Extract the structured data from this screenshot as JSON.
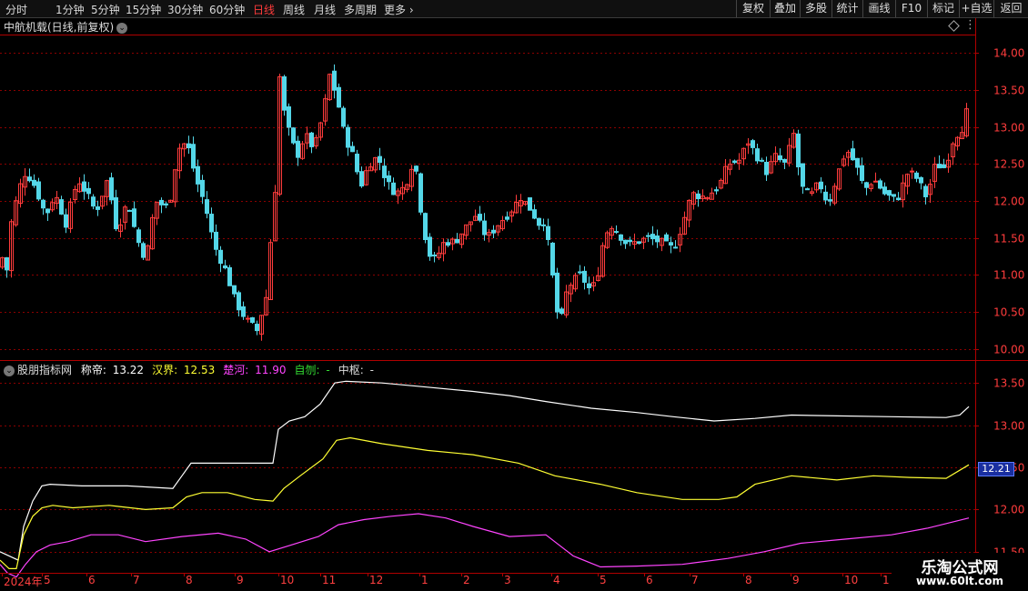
{
  "toolbar": {
    "periods": [
      "分时",
      "1分钟",
      "5分钟",
      "15分钟",
      "30分钟",
      "60分钟",
      "日线",
      "周线",
      "月线",
      "多周期",
      "更多"
    ],
    "active_period": "日线",
    "buttons": [
      "复权",
      "叠加",
      "多股",
      "统计",
      "画线",
      "F10",
      "标记",
      "+自选",
      "返回"
    ]
  },
  "main_chart": {
    "title": "中航机载(日线,前复权)",
    "y_ticks": [
      "14.00",
      "13.50",
      "13.00",
      "12.50",
      "12.00",
      "11.50",
      "11.00",
      "10.50",
      "10.00"
    ],
    "y_range": [
      9.85,
      14.25
    ]
  },
  "indicator": {
    "name": "股朋指标网",
    "items": [
      {
        "label": "称帝:",
        "value": "13.22",
        "color": "#ffffff"
      },
      {
        "label": "汉界:",
        "value": "12.53",
        "color": "#ffff33"
      },
      {
        "label": "楚河:",
        "value": "11.90",
        "color": "#ff44ff"
      },
      {
        "label": "自刎:",
        "value": "-",
        "color": "#33dd33"
      },
      {
        "label": "中枢:",
        "value": "-",
        "color": "#dddddd"
      }
    ],
    "y_ticks": [
      "13.50",
      "13.00",
      "12.50",
      "12.00",
      "11.50"
    ],
    "y_range": [
      11.25,
      13.75
    ],
    "current_price_tag": "12.21"
  },
  "x_axis": {
    "labels": [
      "2024年",
      "5",
      "6",
      "7",
      "8",
      "9",
      "10",
      "11",
      "12",
      "1",
      "2",
      "3",
      "4",
      "5",
      "6",
      "7",
      "8",
      "9",
      "10",
      "1"
    ]
  },
  "watermark": {
    "line1": "乐淘公式网",
    "line2": "www.60lt.com"
  },
  "colors": {
    "up": "#ff3c3c",
    "down": "#54d7e8",
    "grid": "#8b0000",
    "axis": "#b00000"
  },
  "chart_data": [
    {
      "type": "candlestick",
      "title": "中航机载(日线,前复权)",
      "ylim": [
        9.85,
        14.25
      ],
      "anchors_close": [
        [
          0,
          11.1
        ],
        [
          3,
          11.3
        ],
        [
          6,
          10.9
        ],
        [
          10,
          11.6
        ],
        [
          20,
          12.15
        ],
        [
          28,
          12.4
        ],
        [
          38,
          12.2
        ],
        [
          50,
          11.8
        ],
        [
          60,
          12.1
        ],
        [
          72,
          11.7
        ],
        [
          85,
          12.3
        ],
        [
          95,
          12.1
        ],
        [
          105,
          11.85
        ],
        [
          118,
          12.3
        ],
        [
          128,
          11.6
        ],
        [
          140,
          12.0
        ],
        [
          150,
          11.5
        ],
        [
          160,
          11.2
        ],
        [
          170,
          12.0
        ],
        [
          185,
          11.9
        ],
        [
          195,
          12.7
        ],
        [
          205,
          12.8
        ],
        [
          215,
          12.3
        ],
        [
          225,
          11.95
        ],
        [
          235,
          11.4
        ],
        [
          248,
          11.05
        ],
        [
          258,
          10.65
        ],
        [
          270,
          10.4
        ],
        [
          282,
          10.25
        ],
        [
          292,
          10.7
        ],
        [
          298,
          11.6
        ],
        [
          303,
          12.3
        ],
        [
          306,
          13.8
        ],
        [
          310,
          13.3
        ],
        [
          318,
          12.9
        ],
        [
          326,
          12.6
        ],
        [
          335,
          12.9
        ],
        [
          345,
          12.7
        ],
        [
          355,
          13.2
        ],
        [
          362,
          13.7
        ],
        [
          370,
          13.4
        ],
        [
          378,
          12.9
        ],
        [
          388,
          12.6
        ],
        [
          396,
          12.2
        ],
        [
          405,
          12.5
        ],
        [
          415,
          12.6
        ],
        [
          425,
          12.25
        ],
        [
          435,
          12.1
        ],
        [
          445,
          12.2
        ],
        [
          455,
          12.6
        ],
        [
          462,
          11.9
        ],
        [
          470,
          11.3
        ],
        [
          478,
          11.2
        ],
        [
          488,
          11.45
        ],
        [
          500,
          11.45
        ],
        [
          512,
          11.65
        ],
        [
          522,
          11.8
        ],
        [
          535,
          11.5
        ],
        [
          548,
          11.7
        ],
        [
          560,
          11.85
        ],
        [
          572,
          12.05
        ],
        [
          582,
          11.9
        ],
        [
          592,
          11.7
        ],
        [
          600,
          11.75
        ],
        [
          604,
          11.1
        ],
        [
          610,
          10.85
        ],
        [
          614,
          10.15
        ],
        [
          620,
          10.7
        ],
        [
          628,
          10.9
        ],
        [
          638,
          11.0
        ],
        [
          648,
          10.8
        ],
        [
          655,
          10.9
        ],
        [
          662,
          11.4
        ],
        [
          670,
          11.7
        ],
        [
          680,
          11.55
        ],
        [
          690,
          11.4
        ],
        [
          700,
          11.45
        ],
        [
          712,
          11.5
        ],
        [
          725,
          11.45
        ],
        [
          740,
          11.35
        ],
        [
          750,
          11.7
        ],
        [
          760,
          12.1
        ],
        [
          775,
          12.05
        ],
        [
          790,
          12.2
        ],
        [
          800,
          12.5
        ],
        [
          812,
          12.55
        ],
        [
          822,
          12.8
        ],
        [
          832,
          12.6
        ],
        [
          842,
          12.4
        ],
        [
          852,
          12.6
        ],
        [
          862,
          12.5
        ],
        [
          872,
          12.9
        ],
        [
          880,
          12.2
        ],
        [
          890,
          12.05
        ],
        [
          900,
          12.25
        ],
        [
          910,
          11.95
        ],
        [
          920,
          12.35
        ],
        [
          930,
          12.7
        ],
        [
          940,
          12.5
        ],
        [
          950,
          12.15
        ],
        [
          960,
          12.3
        ],
        [
          972,
          12.1
        ],
        [
          985,
          12.0
        ],
        [
          998,
          12.4
        ],
        [
          1008,
          12.3
        ],
        [
          1018,
          12.05
        ],
        [
          1028,
          12.5
        ],
        [
          1038,
          12.45
        ],
        [
          1048,
          12.85
        ],
        [
          1058,
          13.0
        ],
        [
          1062,
          13.2
        ],
        [
          1065,
          13.0
        ]
      ]
    },
    {
      "type": "line",
      "series": [
        {
          "name": "称帝",
          "color": "#ffffff",
          "points": [
            [
              0,
              11.5
            ],
            [
              10,
              11.45
            ],
            [
              20,
              11.4
            ],
            [
              26,
              11.8
            ],
            [
              36,
              12.1
            ],
            [
              46,
              12.28
            ],
            [
              55,
              12.3
            ],
            [
              90,
              12.28
            ],
            [
              140,
              12.28
            ],
            [
              190,
              12.25
            ],
            [
              200,
              12.4
            ],
            [
              210,
              12.55
            ],
            [
              250,
              12.55
            ],
            [
              300,
              12.55
            ],
            [
              306,
              12.95
            ],
            [
              318,
              13.05
            ],
            [
              335,
              13.1
            ],
            [
              352,
              13.25
            ],
            [
              368,
              13.5
            ],
            [
              380,
              13.52
            ],
            [
              420,
              13.5
            ],
            [
              470,
              13.45
            ],
            [
              520,
              13.4
            ],
            [
              560,
              13.35
            ],
            [
              600,
              13.28
            ],
            [
              650,
              13.2
            ],
            [
              700,
              13.15
            ],
            [
              740,
              13.1
            ],
            [
              785,
              13.05
            ],
            [
              830,
              13.08
            ],
            [
              870,
              13.12
            ],
            [
              920,
              13.11
            ],
            [
              980,
              13.1
            ],
            [
              1040,
              13.09
            ],
            [
              1055,
              13.12
            ],
            [
              1065,
              13.22
            ]
          ]
        },
        {
          "name": "汉界",
          "color": "#ffff33",
          "points": [
            [
              0,
              11.4
            ],
            [
              10,
              11.3
            ],
            [
              18,
              11.3
            ],
            [
              26,
              11.7
            ],
            [
              36,
              11.92
            ],
            [
              46,
              12.02
            ],
            [
              58,
              12.05
            ],
            [
              80,
              12.02
            ],
            [
              120,
              12.05
            ],
            [
              160,
              12.0
            ],
            [
              190,
              12.02
            ],
            [
              205,
              12.15
            ],
            [
              222,
              12.2
            ],
            [
              250,
              12.2
            ],
            [
              280,
              12.12
            ],
            [
              300,
              12.1
            ],
            [
              312,
              12.25
            ],
            [
              330,
              12.4
            ],
            [
              355,
              12.6
            ],
            [
              370,
              12.82
            ],
            [
              385,
              12.85
            ],
            [
              420,
              12.78
            ],
            [
              470,
              12.7
            ],
            [
              520,
              12.65
            ],
            [
              570,
              12.55
            ],
            [
              610,
              12.4
            ],
            [
              660,
              12.3
            ],
            [
              700,
              12.2
            ],
            [
              750,
              12.12
            ],
            [
              790,
              12.12
            ],
            [
              810,
              12.15
            ],
            [
              830,
              12.3
            ],
            [
              870,
              12.4
            ],
            [
              920,
              12.35
            ],
            [
              960,
              12.4
            ],
            [
              1000,
              12.38
            ],
            [
              1040,
              12.37
            ],
            [
              1065,
              12.53
            ]
          ]
        },
        {
          "name": "楚河",
          "color": "#ff44ff",
          "points": [
            [
              0,
              11.35
            ],
            [
              8,
              11.25
            ],
            [
              18,
              11.2
            ],
            [
              28,
              11.35
            ],
            [
              40,
              11.5
            ],
            [
              55,
              11.58
            ],
            [
              75,
              11.62
            ],
            [
              100,
              11.7
            ],
            [
              130,
              11.7
            ],
            [
              160,
              11.62
            ],
            [
              200,
              11.68
            ],
            [
              240,
              11.72
            ],
            [
              270,
              11.65
            ],
            [
              296,
              11.5
            ],
            [
              320,
              11.58
            ],
            [
              350,
              11.68
            ],
            [
              372,
              11.82
            ],
            [
              400,
              11.88
            ],
            [
              430,
              11.92
            ],
            [
              460,
              11.95
            ],
            [
              490,
              11.9
            ],
            [
              520,
              11.8
            ],
            [
              560,
              11.68
            ],
            [
              600,
              11.7
            ],
            [
              630,
              11.45
            ],
            [
              660,
              11.32
            ],
            [
              700,
              11.33
            ],
            [
              750,
              11.35
            ],
            [
              800,
              11.42
            ],
            [
              840,
              11.5
            ],
            [
              880,
              11.6
            ],
            [
              930,
              11.65
            ],
            [
              980,
              11.7
            ],
            [
              1020,
              11.78
            ],
            [
              1065,
              11.9
            ]
          ]
        }
      ]
    }
  ]
}
